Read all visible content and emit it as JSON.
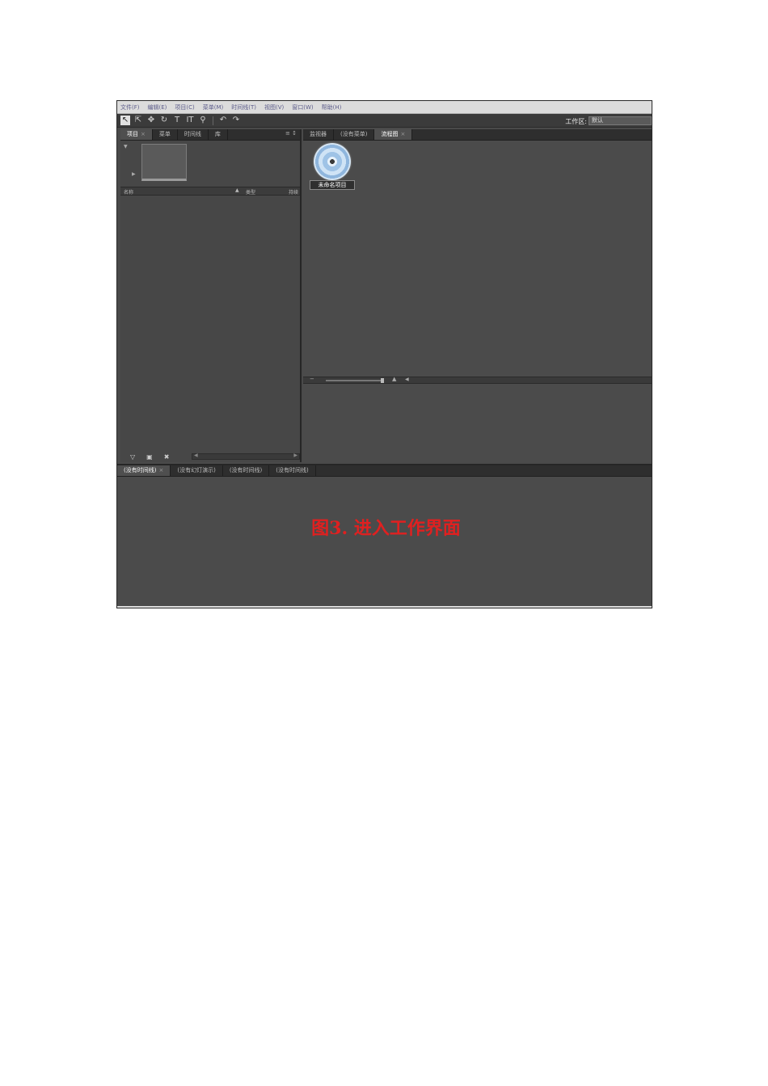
{
  "menu": [
    "文件(F)",
    "编辑(E)",
    "项目(C)",
    "菜单(M)",
    "时间线(T)",
    "视图(V)",
    "窗口(W)",
    "帮助(H)"
  ],
  "toolbar": {
    "tools": [
      "selection-icon",
      "direct-select-icon",
      "move-icon",
      "rotate-icon",
      "text-icon",
      "vertical-text-icon",
      "zoom-icon",
      "undo-icon",
      "redo-icon"
    ],
    "workspace_label": "工作区:",
    "workspace_value": "默认"
  },
  "project_panel": {
    "tabs": [
      {
        "label": "项目",
        "active": true,
        "closable": true
      },
      {
        "label": "菜单",
        "active": false
      },
      {
        "label": "时间线",
        "active": false
      },
      {
        "label": "库",
        "active": false
      }
    ],
    "columns": {
      "name": "名称",
      "type": "类型",
      "duration": "持续"
    }
  },
  "main_panel": {
    "tabs": [
      {
        "label": "监视器",
        "active": false
      },
      {
        "label": "(没有菜单)",
        "active": false
      },
      {
        "label": "流程图",
        "active": true,
        "closable": true
      }
    ],
    "project_node_label": "未命名项目"
  },
  "timeline_panel": {
    "tabs": [
      {
        "label": "(没有时间线)",
        "active": true,
        "closable": true
      },
      {
        "label": "(没有幻灯演示)",
        "active": false
      },
      {
        "label": "(没有时间线)",
        "active": false
      },
      {
        "label": "(没有时间线)",
        "active": false
      }
    ],
    "caption": "图3. 进入工作界面"
  },
  "colors": {
    "caption": "#e02020",
    "panel": "#4b4b4b",
    "menubar": "#dcdcdc"
  }
}
